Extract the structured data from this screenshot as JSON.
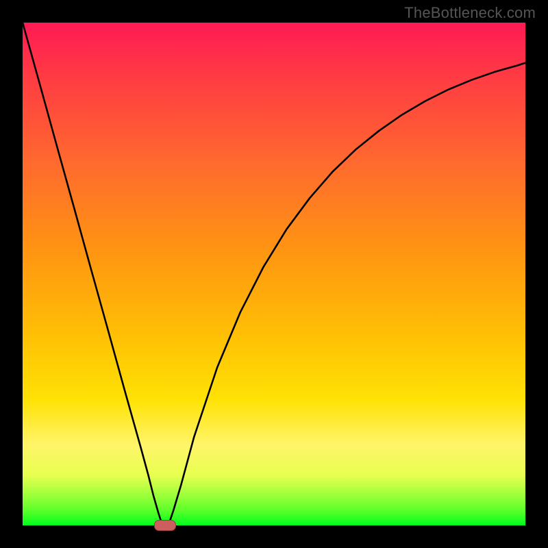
{
  "watermark": "TheBottleneck.com",
  "chart_data": {
    "type": "line",
    "title": "",
    "xlabel": "",
    "ylabel": "",
    "xlim": [
      0,
      100
    ],
    "ylim": [
      0,
      100
    ],
    "grid": false,
    "legend": false,
    "background_gradient_stops": [
      {
        "pos": 0,
        "color": "#ff1a55"
      },
      {
        "pos": 10,
        "color": "#ff3944"
      },
      {
        "pos": 28,
        "color": "#ff6a2e"
      },
      {
        "pos": 45,
        "color": "#ff9412"
      },
      {
        "pos": 62,
        "color": "#ffbf05"
      },
      {
        "pos": 75,
        "color": "#ffe205"
      },
      {
        "pos": 84,
        "color": "#fff56a"
      },
      {
        "pos": 90,
        "color": "#e8ff50"
      },
      {
        "pos": 94,
        "color": "#9cff3a"
      },
      {
        "pos": 97,
        "color": "#5cff2a"
      },
      {
        "pos": 100,
        "color": "#00ff1e"
      }
    ],
    "series": [
      {
        "name": "left-branch",
        "x": [
          0.0,
          3.4,
          6.8,
          10.2,
          13.6,
          17.0,
          20.4,
          23.5,
          25.0,
          26.0,
          27.0,
          27.8
        ],
        "y": [
          100.0,
          87.8,
          75.5,
          63.3,
          51.0,
          38.8,
          26.5,
          15.5,
          10.0,
          6.0,
          2.5,
          0.0
        ]
      },
      {
        "name": "right-branch",
        "x": [
          29.0,
          30.0,
          31.5,
          34.1,
          38.7,
          43.3,
          47.9,
          52.5,
          57.1,
          61.7,
          66.3,
          70.9,
          75.5,
          80.1,
          84.7,
          89.3,
          93.9,
          98.5,
          100.0
        ],
        "y": [
          0.0,
          3.0,
          8.0,
          17.6,
          31.4,
          42.4,
          51.4,
          58.9,
          65.1,
          70.4,
          74.8,
          78.5,
          81.7,
          84.4,
          86.7,
          88.6,
          90.2,
          91.5,
          92.0
        ]
      }
    ],
    "marker": {
      "x": 28.4,
      "y": 0.0,
      "color": "#cd5e5e"
    }
  }
}
